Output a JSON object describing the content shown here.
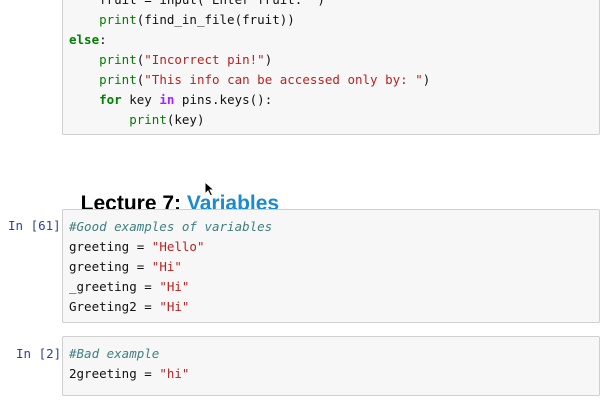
{
  "cell_prev": {
    "lines": [
      {
        "indent": "    ",
        "parts": [
          {
            "t": "fruit = input(\"Enter fruit: \")",
            "c": ""
          }
        ]
      },
      {
        "indent": "    ",
        "parts": [
          {
            "t": "print",
            "c": "bi"
          },
          {
            "t": "(find_in_file(fruit))",
            "c": ""
          }
        ]
      },
      {
        "indent": "",
        "parts": [
          {
            "t": "else",
            "c": "kw"
          },
          {
            "t": ":",
            "c": ""
          }
        ]
      },
      {
        "indent": "    ",
        "parts": [
          {
            "t": "print",
            "c": "bi"
          },
          {
            "t": "(",
            "c": ""
          },
          {
            "t": "\"Incorrect pin!\"",
            "c": "str"
          },
          {
            "t": ")",
            "c": ""
          }
        ]
      },
      {
        "indent": "    ",
        "parts": [
          {
            "t": "print",
            "c": "bi"
          },
          {
            "t": "(",
            "c": ""
          },
          {
            "t": "\"This info can be accessed only by: \"",
            "c": "str"
          },
          {
            "t": ")",
            "c": ""
          }
        ]
      },
      {
        "indent": "    ",
        "parts": [
          {
            "t": "for",
            "c": "kw"
          },
          {
            "t": " key ",
            "c": ""
          },
          {
            "t": "in",
            "c": "op"
          },
          {
            "t": " pins.keys():",
            "c": ""
          }
        ]
      },
      {
        "indent": "        ",
        "parts": [
          {
            "t": "print",
            "c": "bi"
          },
          {
            "t": "(key)",
            "c": ""
          }
        ]
      }
    ]
  },
  "heading": {
    "prefix": "Lecture 7: ",
    "link_text": "Variables"
  },
  "cell_61": {
    "prompt": "In [61]:",
    "lines": [
      {
        "indent": "",
        "parts": [
          {
            "t": "#Good examples of variables",
            "c": "cm"
          }
        ]
      },
      {
        "indent": "",
        "parts": [
          {
            "t": "greeting = ",
            "c": ""
          },
          {
            "t": "\"Hello\"",
            "c": "str"
          }
        ]
      },
      {
        "indent": "",
        "parts": [
          {
            "t": "greeting = ",
            "c": ""
          },
          {
            "t": "\"Hi\"",
            "c": "str"
          }
        ]
      },
      {
        "indent": "",
        "parts": [
          {
            "t": "_greeting = ",
            "c": ""
          },
          {
            "t": "\"Hi\"",
            "c": "str"
          }
        ]
      },
      {
        "indent": "",
        "parts": [
          {
            "t": "Greeting2 = ",
            "c": ""
          },
          {
            "t": "\"Hi\"",
            "c": "str"
          }
        ]
      }
    ]
  },
  "cell_2": {
    "prompt": "In [2]:",
    "lines": [
      {
        "indent": "",
        "parts": [
          {
            "t": "#Bad example",
            "c": "cm"
          }
        ]
      },
      {
        "indent": "",
        "parts": [
          {
            "t": "2greeting = ",
            "c": ""
          },
          {
            "t": "\"hi\"",
            "c": "str"
          }
        ]
      }
    ]
  },
  "icons": {
    "cursor": "mouse-pointer-icon"
  }
}
